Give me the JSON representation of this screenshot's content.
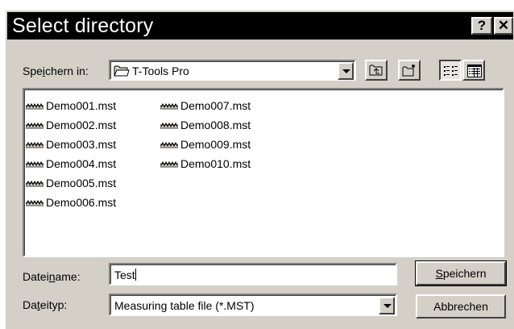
{
  "window": {
    "title": "Select directory",
    "help_label": "?",
    "close_label": "✕"
  },
  "location": {
    "label_prefix": "Spe",
    "label_accel": "i",
    "label_suffix": "chern in:",
    "current_folder": "T-Tools Pro",
    "folder_icon": "folder-icon"
  },
  "toolbar": {
    "buttons": [
      "up-one-level-icon",
      "create-new-folder-icon",
      "list-view-icon",
      "details-view-icon"
    ]
  },
  "files": [
    "Demo001.mst",
    "Demo002.mst",
    "Demo003.mst",
    "Demo004.mst",
    "Demo005.mst",
    "Demo006.mst",
    "Demo007.mst",
    "Demo008.mst",
    "Demo009.mst",
    "Demo010.mst"
  ],
  "filename": {
    "label_prefix": "Datei",
    "label_accel": "n",
    "label_suffix": "ame:",
    "value": "Test"
  },
  "filetype": {
    "label_prefix": "Da",
    "label_accel": "t",
    "label_suffix": "eityp:",
    "value": "Measuring table file (*.MST)"
  },
  "buttons": {
    "save_accel": "S",
    "save_rest": "peichern",
    "cancel_label": "Abbrechen"
  }
}
